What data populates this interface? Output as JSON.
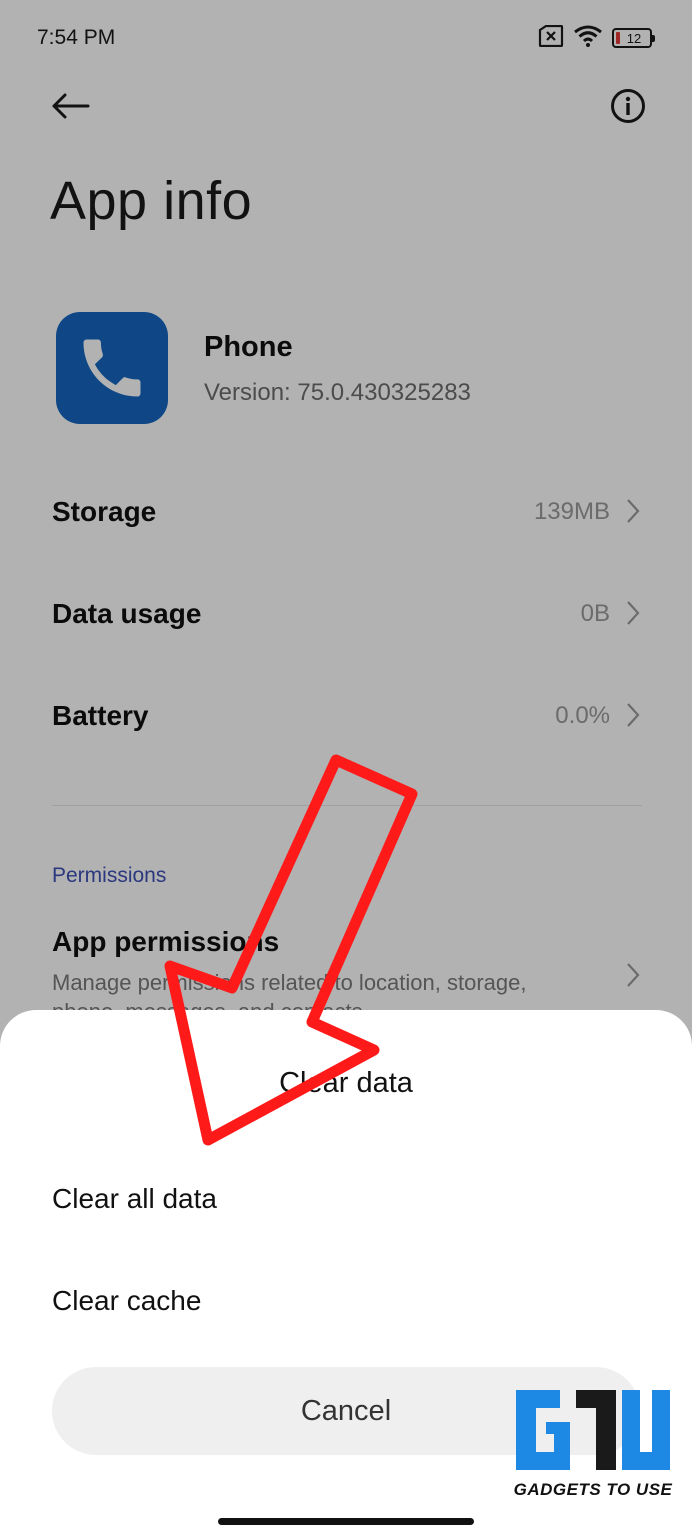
{
  "status_bar": {
    "time": "7:54 PM",
    "battery_level": "12",
    "icons": [
      "no-sim-icon",
      "wifi-icon",
      "battery-icon"
    ]
  },
  "header": {
    "back_icon": "back-arrow-icon",
    "info_icon": "info-icon",
    "title": "App info"
  },
  "app": {
    "name": "Phone",
    "version": "Version: 75.0.430325283",
    "icon": "phone-handset-icon",
    "icon_color": "#1565c0"
  },
  "rows": [
    {
      "label": "Storage",
      "value": "139MB"
    },
    {
      "label": "Data usage",
      "value": "0B"
    },
    {
      "label": "Battery",
      "value": "0.0%"
    }
  ],
  "permissions": {
    "section_header": "Permissions",
    "title": "App permissions",
    "description": "Manage permissions related to location, storage, phone, messages, and contacts."
  },
  "dialog": {
    "title": "Clear data",
    "options": [
      "Clear all data",
      "Clear cache"
    ],
    "cancel_label": "Cancel"
  },
  "annotation": {
    "arrow_color": "#ff1a1a"
  },
  "watermark": {
    "text": "GADGETS TO USE"
  }
}
